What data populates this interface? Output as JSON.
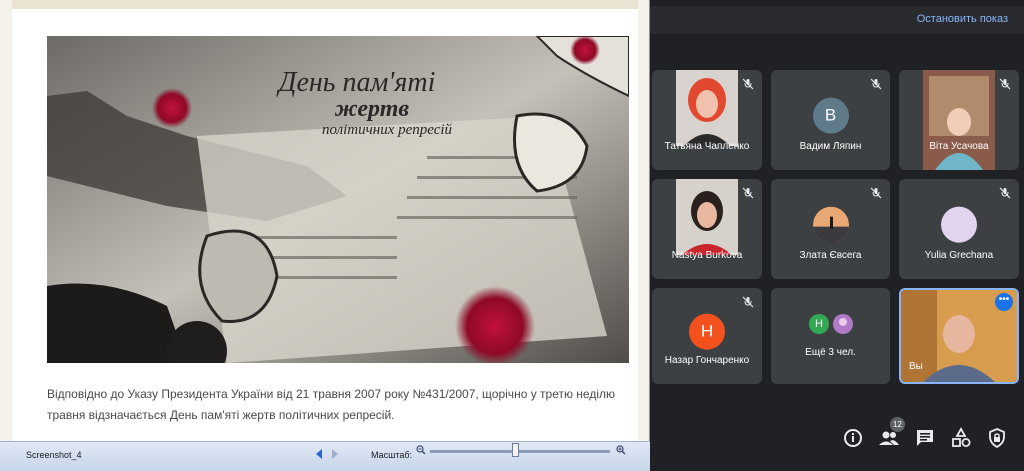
{
  "meet": {
    "stop_presenting": "Остановить показ",
    "participants_count": "12",
    "tiles": [
      {
        "name": "Татьяна Чапленко",
        "kind": "video",
        "muted": true
      },
      {
        "name": "Вадим Ляпин",
        "kind": "avatar",
        "initial": "В",
        "color": "#5f7b8a",
        "muted": true
      },
      {
        "name": "Віта Усачова",
        "kind": "video",
        "muted": true
      },
      {
        "name": "Nastya Burkova",
        "kind": "video",
        "muted": true
      },
      {
        "name": "Злата Євсега",
        "kind": "avatar-photo",
        "muted": true
      },
      {
        "name": "Yulia Grechana",
        "kind": "avatar",
        "initial": "",
        "color": "#e1d4ef",
        "muted": true
      },
      {
        "name": "Назар Гончаренко",
        "kind": "avatar",
        "initial": "Н",
        "color": "#f4511e",
        "muted": true
      },
      {
        "name": "Ещё 3 чел.",
        "kind": "group",
        "initial": "Н",
        "muted": false
      },
      {
        "name": "Вы",
        "kind": "self",
        "muted": false
      }
    ]
  },
  "viewer": {
    "hero_title_1": "День пам'яті",
    "hero_title_2": "жертв",
    "hero_title_3": "політичних репресій",
    "caption": "Відповідно до Указу Президента України від 21 травня 2007 року №431/2007, щорічно у третю неділю травня відзначається День пам'яті жертв політичних репресій.",
    "filename": "Screenshot_4",
    "zoom_label": "Масштаб:",
    "zoom_level": 0.47
  }
}
